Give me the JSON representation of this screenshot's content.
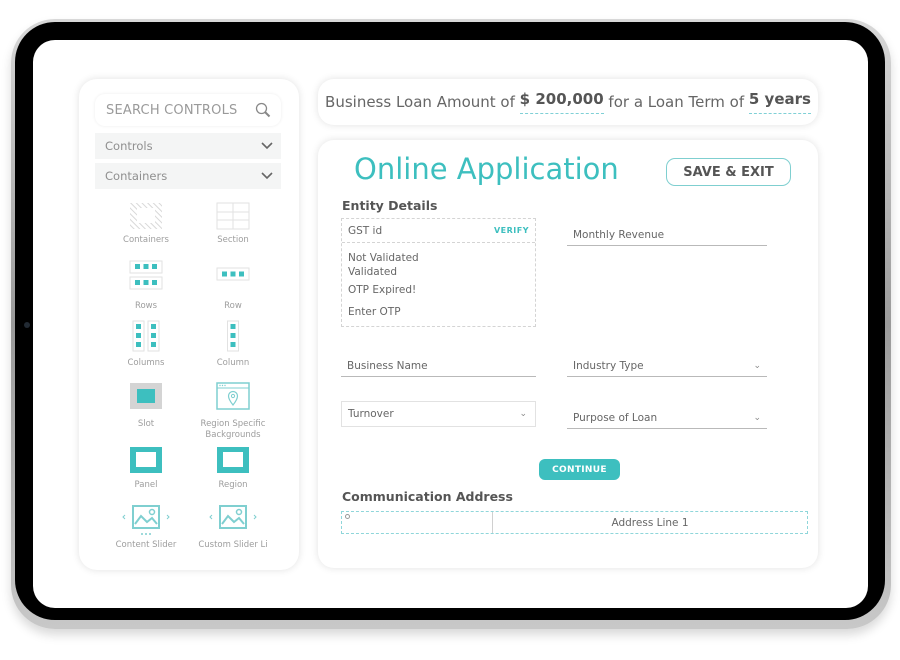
{
  "sidebar": {
    "search_placeholder": "SEARCH CONTROLS",
    "accordions": [
      {
        "label": "Controls",
        "icon": "chevron-down-icon"
      },
      {
        "label": "Containers",
        "icon": "chevron-down-icon"
      }
    ],
    "tiles": [
      {
        "label": "Containers",
        "icon": "containers-icon"
      },
      {
        "label": "Section",
        "icon": "section-icon"
      },
      {
        "label": "Rows",
        "icon": "rows-icon"
      },
      {
        "label": "Row",
        "icon": "row-icon"
      },
      {
        "label": "Columns",
        "icon": "columns-icon"
      },
      {
        "label": "Column",
        "icon": "column-icon"
      },
      {
        "label": "Slot",
        "icon": "slot-icon"
      },
      {
        "label": "Region Specific Backgrounds",
        "icon": "region-backgrounds-icon"
      },
      {
        "label": "Panel",
        "icon": "panel-icon"
      },
      {
        "label": "Region",
        "icon": "region-icon"
      },
      {
        "label": "Content Slider",
        "icon": "content-slider-icon"
      },
      {
        "label": "Custom Slider Li",
        "icon": "custom-slider-icon"
      }
    ]
  },
  "banner": {
    "prefix": "Business Loan Amount of",
    "amount": "$ 200,000",
    "middle": "for a Loan Term of",
    "term": "5 years"
  },
  "application": {
    "title": "Online Application",
    "save_exit_label": "SAVE & EXIT",
    "entity_section_title": "Entity Details",
    "gst": {
      "label": "GST id",
      "verify_label": "VERIFY",
      "statuses": [
        "Not Validated",
        "Validated",
        "OTP Expired!"
      ],
      "otp_placeholder": "Enter OTP"
    },
    "fields": {
      "monthly_revenue": "Monthly Revenue",
      "business_name": "Business Name",
      "industry_type": "Industry Type",
      "turnover": "Turnover",
      "purpose_of_loan": "Purpose of Loan"
    },
    "continue_label": "CONTINUE",
    "comm_section_title": "Communication Address",
    "address_line_1": "Address Line 1"
  },
  "colors": {
    "accent": "#3dbfbf",
    "text": "#555555",
    "muted": "#9d9d9d"
  }
}
